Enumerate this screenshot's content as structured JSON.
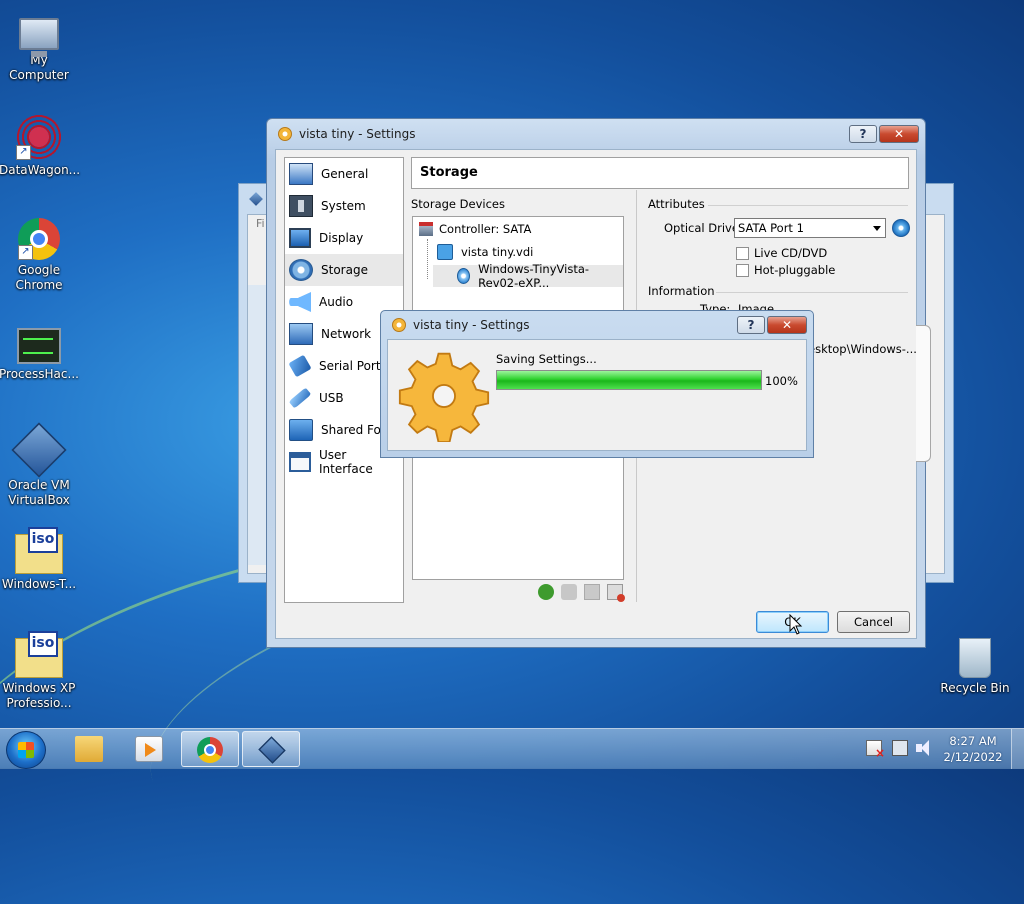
{
  "desktop": {
    "icons": [
      {
        "label": "My Computer",
        "icon": "computer-icon"
      },
      {
        "label": "DataWagon...",
        "icon": "datawagon-icon"
      },
      {
        "label": "Google Chrome",
        "icon": "chrome-icon"
      },
      {
        "label": "ProcessHac...",
        "icon": "processhacker-icon"
      },
      {
        "label": "Oracle VM VirtualBox",
        "icon": "virtualbox-icon"
      },
      {
        "label": "Windows-T...",
        "icon": "iso-file-icon"
      },
      {
        "label": "Windows XP Professio...",
        "icon": "iso-file-icon"
      },
      {
        "label": "Recycle Bin",
        "icon": "recycle-bin-icon"
      }
    ],
    "iso_badge": "iso"
  },
  "background_window": {
    "title_fragment": "Fi"
  },
  "settings_window": {
    "title": "vista tiny - Settings",
    "help_label": "?",
    "close_label": "✕",
    "nav": [
      {
        "label": "General",
        "icon": "general-icon"
      },
      {
        "label": "System",
        "icon": "system-icon"
      },
      {
        "label": "Display",
        "icon": "display-icon"
      },
      {
        "label": "Storage",
        "icon": "storage-icon",
        "selected": true
      },
      {
        "label": "Audio",
        "icon": "audio-icon"
      },
      {
        "label": "Network",
        "icon": "network-icon"
      },
      {
        "label": "Serial Ports",
        "icon": "serial-ports-icon"
      },
      {
        "label": "USB",
        "icon": "usb-icon"
      },
      {
        "label": "Shared Fold",
        "icon": "shared-folders-icon"
      },
      {
        "label": "User Interface",
        "icon": "user-interface-icon"
      }
    ],
    "page_title": "Storage",
    "storage_devices_label": "Storage Devices",
    "tree": {
      "controller": "Controller: SATA",
      "items": [
        "vista tiny.vdi",
        "Windows-TinyVista-Rev02-eXP..."
      ]
    },
    "attributes": {
      "heading": "Attributes",
      "optical_drive_label": "Optical Drive:",
      "optical_drive_value": "SATA Port 1",
      "live_cd_label": "Live CD/DVD",
      "live_cd_checked": false,
      "hot_pluggable_label": "Hot-pluggable",
      "hot_pluggable_checked": false
    },
    "information": {
      "heading": "Information",
      "type_label_fragment": "Type:",
      "type_value_fragment": "Image",
      "location_fragment": "esktop\\Windows-..."
    },
    "ok_label": "OK",
    "cancel_label": "Cancel"
  },
  "progress_dialog": {
    "title": "vista tiny - Settings",
    "help_label": "?",
    "close_label": "✕",
    "message": "Saving Settings...",
    "progress": 100,
    "progress_text": "100%"
  },
  "taskbar": {
    "apps": [
      {
        "name": "windows-explorer",
        "icon": "folder-icon"
      },
      {
        "name": "media-player",
        "icon": "media-player-icon"
      },
      {
        "name": "google-chrome",
        "icon": "chrome-icon"
      },
      {
        "name": "virtualbox",
        "icon": "virtualbox-icon",
        "active": true
      }
    ],
    "time": "8:27 AM",
    "date": "2/12/2022"
  }
}
